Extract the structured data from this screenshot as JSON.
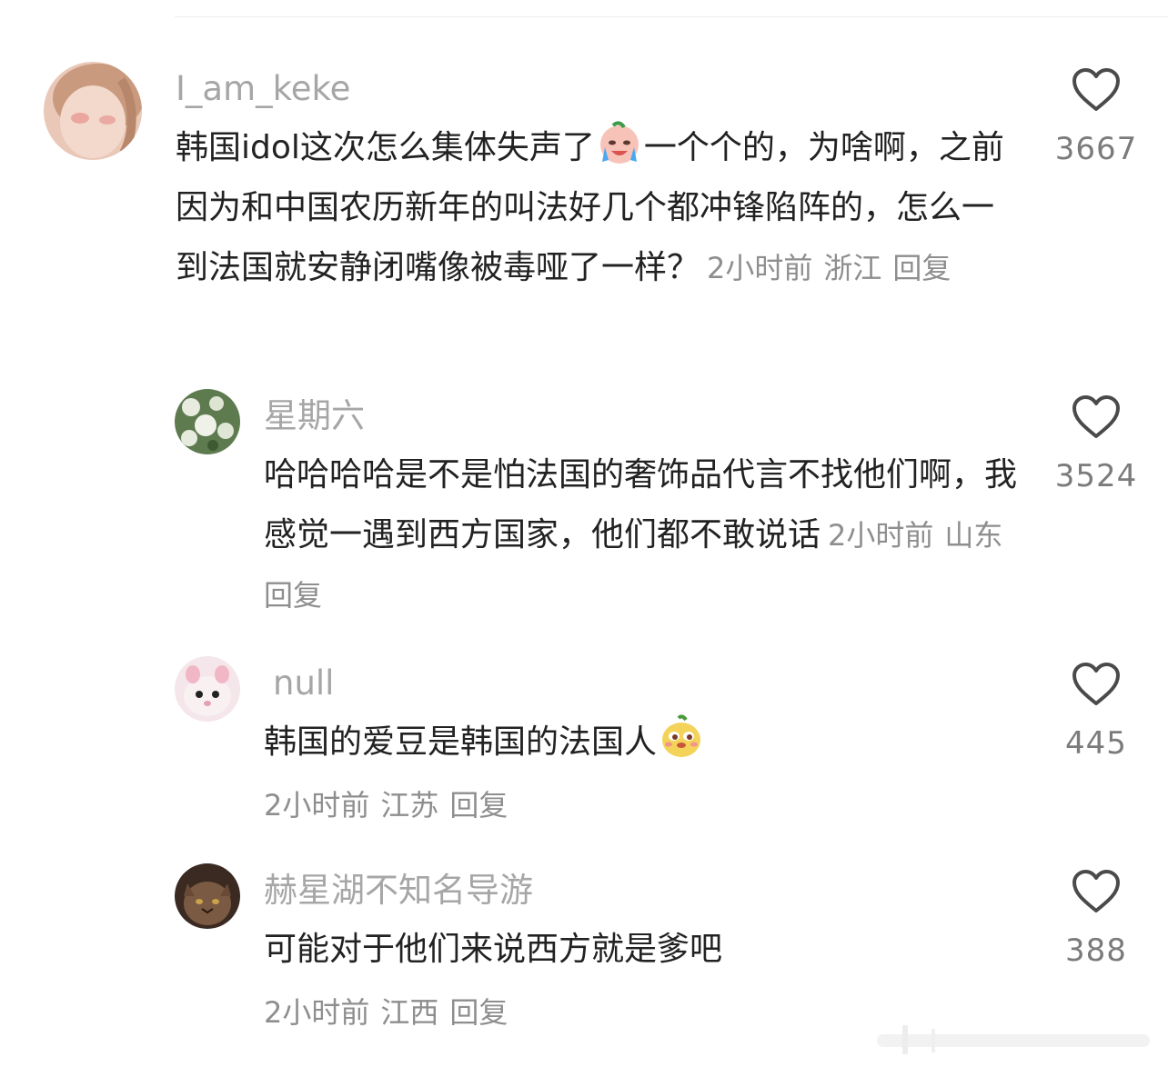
{
  "comments": [
    {
      "username": "I_am_keke",
      "text_before_emoji": "韩国idol这次怎么集体失声了",
      "text_after_emoji": "一个个的，为啥啊，之前因为和中国农历新年的叫法好几个都冲锋陷阵的，怎么一到法国就安静闭嘴像被毒哑了一样？",
      "time": "2小时前",
      "location": "浙江",
      "reply": "回复",
      "likes": "3667"
    },
    {
      "username": "星期六",
      "text": "哈哈哈哈是不是怕法国的奢饰品代言不找他们啊，我感觉一遇到西方国家，他们都不敢说话",
      "time": "2小时前",
      "location": "山东",
      "reply": "回复",
      "likes": "3524"
    },
    {
      "username": "null",
      "text": "韩国的爱豆是韩国的法国人",
      "time": "2小时前",
      "location": "江苏",
      "reply": "回复",
      "likes": "445"
    },
    {
      "username": "赫星湖不知名导游",
      "text": "可能对于他们来说西方就是爹吧",
      "time": "2小时前",
      "location": "江西",
      "reply": "回复",
      "likes": "388"
    }
  ],
  "icons": {
    "like": "heart-outline-icon",
    "emoji_1": "crying-face-emoji",
    "emoji_2": "smirking-mascot-emoji"
  },
  "colors": {
    "username": "#a6a6a6",
    "text": "#222222",
    "meta": "#8e8e8e",
    "like_count": "#7b7b7b"
  }
}
